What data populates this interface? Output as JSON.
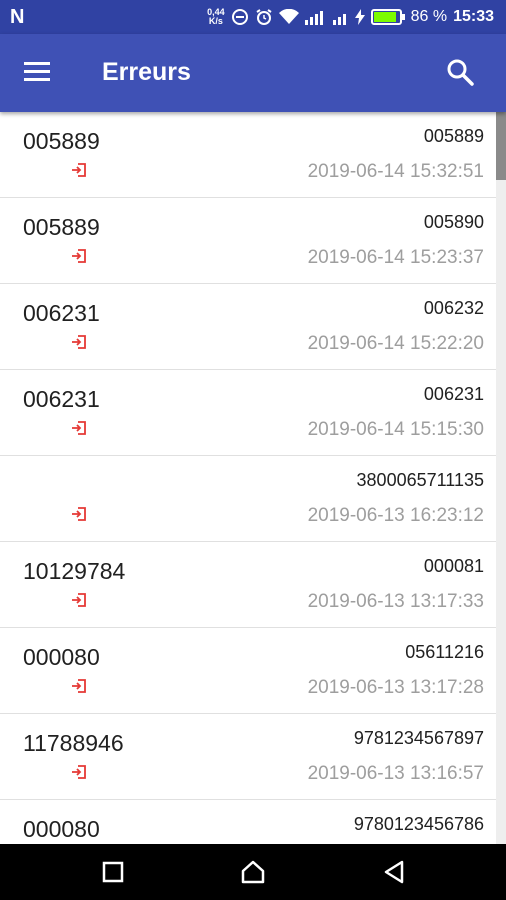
{
  "status_bar": {
    "carrier": "N",
    "net_speed_value": "0,44",
    "net_speed_unit": "K/s",
    "battery_percent": "86 %",
    "time": "15:33"
  },
  "app_bar": {
    "title": "Erreurs"
  },
  "rows": [
    {
      "code": "005889",
      "barcode": "005889",
      "datetime": "2019-06-14 15:32:51"
    },
    {
      "code": "005889",
      "barcode": "005890",
      "datetime": "2019-06-14 15:23:37"
    },
    {
      "code": "006231",
      "barcode": "006232",
      "datetime": "2019-06-14 15:22:20"
    },
    {
      "code": "006231",
      "barcode": "006231",
      "datetime": "2019-06-14 15:15:30"
    },
    {
      "code": "",
      "barcode": "3800065711135",
      "datetime": "2019-06-13 16:23:12"
    },
    {
      "code": "10129784",
      "barcode": "000081",
      "datetime": "2019-06-13 13:17:33"
    },
    {
      "code": "000080",
      "barcode": "05611216",
      "datetime": "2019-06-13 13:17:28"
    },
    {
      "code": "11788946",
      "barcode": "9781234567897",
      "datetime": "2019-06-13 13:16:57"
    },
    {
      "code": "000080",
      "barcode": "9780123456786",
      "datetime": ""
    }
  ],
  "colors": {
    "status_bar": "#3042a3",
    "app_bar": "#3f51b5",
    "login_icon": "#e53935",
    "date_text": "#9e9e9e"
  },
  "icons": {
    "menu": "hamburger-menu-icon",
    "search": "magnifier-search-icon",
    "row": "login-arrow-icon",
    "nav_back": "triangle-back-icon",
    "nav_home": "house-home-icon",
    "nav_recents": "square-recents-icon"
  }
}
